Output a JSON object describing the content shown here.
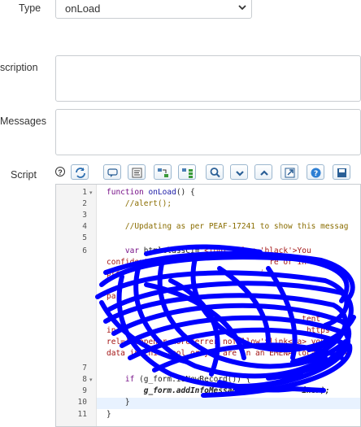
{
  "form": {
    "type_label": "Type",
    "type_value": "onLoad",
    "description_label": "scription",
    "messages_label": "Messages",
    "script_label": "Script"
  },
  "toolbar": {
    "buttons": [
      "toggle-syntax",
      "comment",
      "format",
      "replace",
      "replace-all",
      "search",
      "next",
      "previous",
      "fullscreen",
      "help",
      "save"
    ]
  },
  "editor": {
    "line_numbers": [
      "1",
      "2",
      "3",
      "4",
      "5",
      "6",
      "7",
      "8",
      "9",
      "10",
      "11"
    ],
    "lines": {
      "l1_kw": "function",
      "l1_fn": "onLoad",
      "l1_rest": "() {",
      "l2": "    //alert();",
      "l4": "    //Updating as per PEAF-17241 to show this messag",
      "l6_kw": "var",
      "l6_rest": " htmlclassCI=",
      "l6_str": "\"<font color='black'>You",
      "w1": "confidential",
      "w1b": "re or in",
      "w2": "pre",
      "w2b": "ci",
      "w3": "pa",
      "w4": "(",
      "w4b": "tent",
      "w5": "in",
      "w5b": "https",
      "w6": "rel='noopener noreferrer nofollow'>link</a> you d",
      "w7": "data in this tool or you are in an EMENA location</f",
      "l8_kw": "if",
      "l8_rest": " (g_form.isNewRecord()) {",
      "l9": "        g_form.addInfoMessage(ht",
      "l9b": "iner);",
      "l10": "    }",
      "l11": "}"
    }
  },
  "colors": {
    "scribble": "#0000ff",
    "border": "#c9cdd1"
  }
}
